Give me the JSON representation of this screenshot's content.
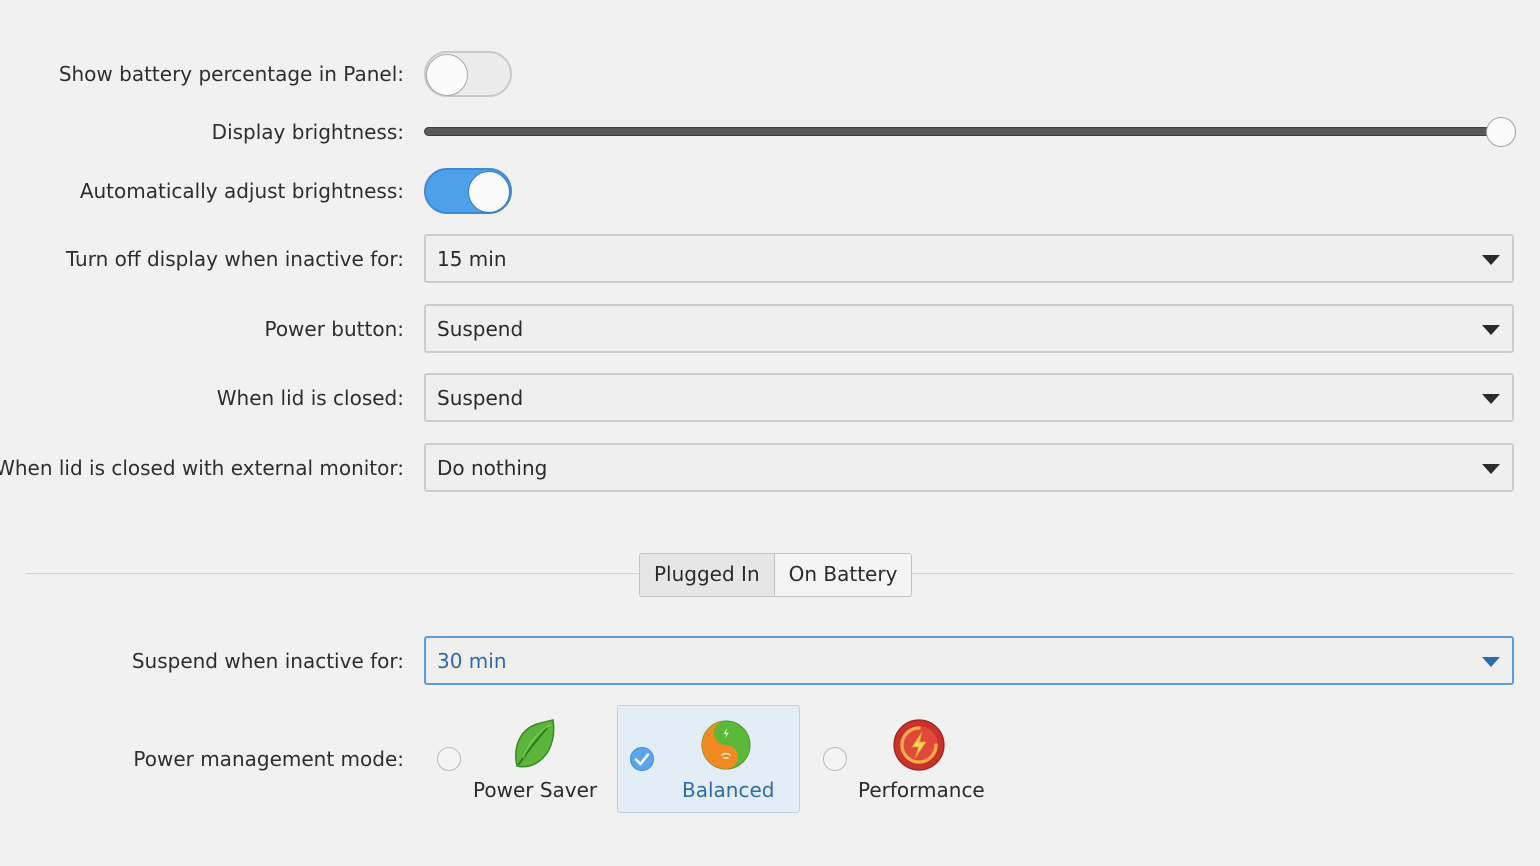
{
  "settings": {
    "show_battery_percentage": {
      "label": "Show battery percentage in Panel:",
      "state": "off"
    },
    "display_brightness": {
      "label": "Display brightness:",
      "level_percent": 100
    },
    "auto_brightness": {
      "label": "Automatically adjust brightness:",
      "state": "on"
    },
    "turn_off_display": {
      "label": "Turn off display when inactive for:",
      "value": "15 min"
    },
    "power_button": {
      "label": "Power button:",
      "value": "Suspend"
    },
    "lid_closed": {
      "label": "When lid is closed:",
      "value": "Suspend"
    },
    "lid_closed_external": {
      "label": "When lid is closed with external monitor:",
      "value": "Do nothing"
    }
  },
  "tabs": {
    "plugged_in": "Plugged In",
    "on_battery": "On Battery",
    "active": "Plugged In"
  },
  "power_profile": {
    "suspend_inactive": {
      "label": "Suspend when inactive for:",
      "value": "30 min"
    },
    "mode_label": "Power management mode:",
    "modes": [
      {
        "name": "Power Saver",
        "icon": "leaf-icon",
        "selected": false
      },
      {
        "name": "Balanced",
        "icon": "yin-yang-icon",
        "selected": true
      },
      {
        "name": "Performance",
        "icon": "lightning-icon",
        "selected": false
      }
    ]
  },
  "colors": {
    "accent": "#4fa0ea",
    "focus_text": "#2f6ba8",
    "background": "#f1f1f1"
  }
}
